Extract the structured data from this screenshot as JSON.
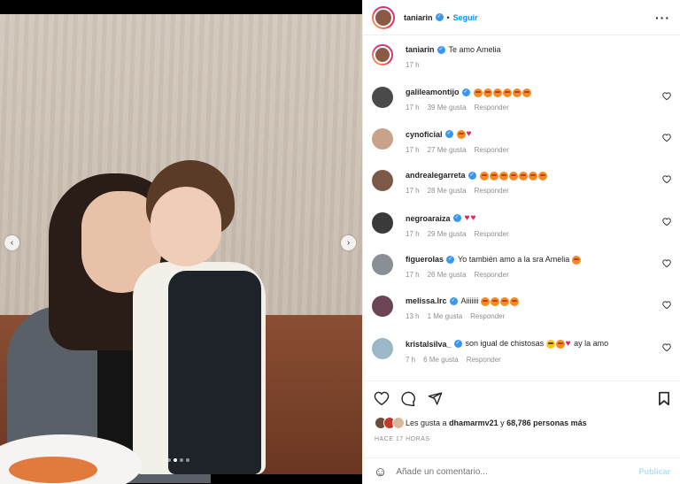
{
  "post": {
    "author": "taniarin",
    "follow_label": "Seguir",
    "separator": "•",
    "more_icon": "more-options-icon"
  },
  "caption": {
    "username": "taniarin",
    "text": "Te amo Amelia",
    "time": "17 h"
  },
  "comments": [
    {
      "username": "galileamontijo",
      "text": "",
      "emojis": [
        "heart-eyes",
        "heart-eyes",
        "heart-eyes",
        "heart-eyes",
        "heart-eyes",
        "heart-eyes"
      ],
      "time": "17 h",
      "likes": "39 Me gusta",
      "reply": "Responder",
      "verified": true
    },
    {
      "username": "cynoficial",
      "text": "",
      "emojis": [
        "heart-eyes",
        "red-heart"
      ],
      "time": "17 h",
      "likes": "27 Me gusta",
      "reply": "Responder",
      "verified": true
    },
    {
      "username": "andrealegarreta",
      "text": "",
      "emojis": [
        "heart-eyes",
        "heart-eyes",
        "heart-eyes",
        "heart-eyes",
        "heart-eyes",
        "heart-eyes",
        "heart-eyes"
      ],
      "time": "17 h",
      "likes": "28 Me gusta",
      "reply": "Responder",
      "verified": true
    },
    {
      "username": "negroaraiza",
      "text": "",
      "emojis": [
        "red-heart",
        "red-heart"
      ],
      "time": "17 h",
      "likes": "29 Me gusta",
      "reply": "Responder",
      "verified": true
    },
    {
      "username": "figuerolas",
      "text": "Yo también amo a la sra Amelia",
      "emojis": [
        "heart-eyes"
      ],
      "time": "17 h",
      "likes": "26 Me gusta",
      "reply": "Responder",
      "verified": true
    },
    {
      "username": "melissa.lrc",
      "text": "Aiiiiiii",
      "emojis": [
        "heart-eyes",
        "heart-eyes",
        "heart-eyes",
        "heart-eyes"
      ],
      "time": "13 h",
      "likes": "1 Me gusta",
      "reply": "Responder",
      "verified": true
    },
    {
      "username": "kristalsilva_",
      "text": "son igual de chistosas",
      "emojis": [
        "laughing",
        "heart-eyes",
        "red-heart"
      ],
      "suffix": "ay la amo",
      "time": "7 h",
      "likes": "6 Me gusta",
      "reply": "Responder",
      "verified": true
    }
  ],
  "actions": {
    "likes_prefix": "Les gusta a",
    "likes_user": "dhamarmv21",
    "likes_middle": "y",
    "likes_count": "68,786 personas más",
    "timestamp": "HACE 17 HORAS"
  },
  "add_comment": {
    "placeholder": "Añade un comentario...",
    "post_label": "Publicar"
  },
  "carousel": {
    "total": 4,
    "active": 2
  },
  "colors": {
    "accent": "#0095f6",
    "verified": "#3897f0",
    "muted": "#8e8e8e",
    "post_disabled": "#b2dffc"
  }
}
